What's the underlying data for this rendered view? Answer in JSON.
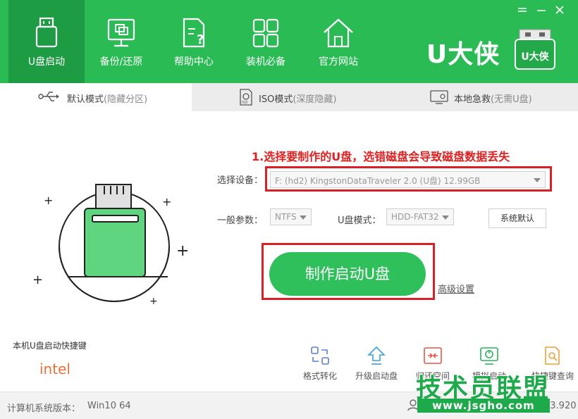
{
  "app": {
    "brand": "U大侠",
    "logo_text": "U大侠",
    "colors": {
      "header": "#2bbb55",
      "header_active": "#1e9c44",
      "accent": "#2fbf5b",
      "warning": "#e02020",
      "highlight_box": "#d92027"
    }
  },
  "window_controls": [
    {
      "icon": "minimize-icon"
    },
    {
      "icon": "close-icon"
    }
  ],
  "nav": [
    {
      "label": "U盘启动",
      "icon": "usb-drive-icon",
      "active": true
    },
    {
      "label": "备份/还原",
      "icon": "backup-restore-icon",
      "active": false
    },
    {
      "label": "帮助中心",
      "icon": "help-document-icon",
      "active": false
    },
    {
      "label": "装机必备",
      "icon": "apps-grid-icon",
      "active": false
    },
    {
      "label": "官方网站",
      "icon": "home-icon",
      "active": false
    }
  ],
  "modes": [
    {
      "label": "默认模式",
      "sub": "(隐藏分区)",
      "icon": "usb-symbol-icon",
      "active": true
    },
    {
      "label": "ISO模式",
      "sub": "(深度隐藏)",
      "icon": "iso-disc-icon",
      "active": false
    },
    {
      "label": "本地急救",
      "sub": "(无需U盘)",
      "icon": "computer-pin-icon",
      "active": false
    }
  ],
  "form": {
    "hint": "1.选择要制作的U盘，选错磁盘会导致磁盘数据丢失",
    "device_label": "选择设备：",
    "device_value": "F: (hd2) KingstonDataTraveler 2.0 (U盘) 12.99GB",
    "params_label": "一般参数：",
    "params_value": "NTFS",
    "umode_label": "U盘模式：",
    "umode_value": "HDD-FAT32",
    "default_button": "系统默认",
    "make_button": "制作启动U盘",
    "advanced_link": "高级设置"
  },
  "hotkey": {
    "title": "本机U盘启动快捷键",
    "brand": "intel"
  },
  "tools": [
    {
      "label": "格式转化",
      "icon": "format-convert-icon"
    },
    {
      "label": "升级启动盘",
      "icon": "upgrade-icon"
    },
    {
      "label": "归还空间",
      "icon": "return-space-icon"
    },
    {
      "label": "模拟启动",
      "icon": "simulate-boot-icon"
    },
    {
      "label": "快捷键查询",
      "icon": "shortcut-search-icon"
    }
  ],
  "status": {
    "os_label": "计算机系统版本：",
    "os_value": "Win10 64",
    "version": "23.920"
  },
  "watermark": {
    "title": "技术员联盟",
    "url": "www.jsgho.com"
  }
}
